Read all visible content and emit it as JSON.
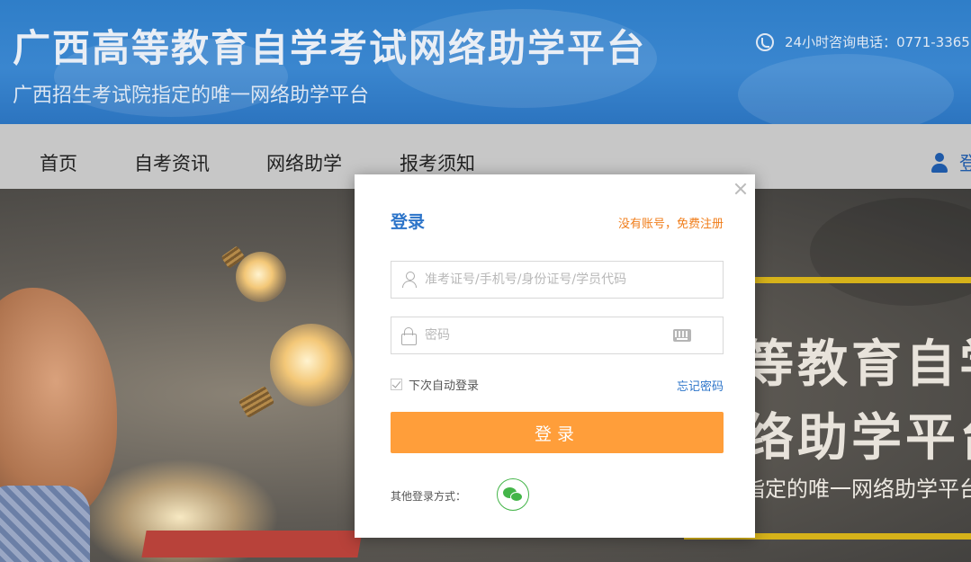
{
  "header": {
    "title": "广西高等教育自学考试网络助学平台",
    "subtitle": "广西招生考试院指定的唯一网络助学平台",
    "hotline_label": "24小时咨询电话：0771-3365",
    "hotline_icon": "phone-icon"
  },
  "nav": {
    "items": [
      {
        "label": "首页"
      },
      {
        "label": "自考资讯"
      },
      {
        "label": "网络助学"
      },
      {
        "label": "报考须知"
      }
    ],
    "login_label": "登",
    "login_icon": "user-icon"
  },
  "banner": {
    "title_line1": "等教育自学",
    "title_line2": "络助学平台",
    "subtitle": "指定的唯一网络助学平台"
  },
  "login_modal": {
    "title": "登录",
    "register_link": "没有账号，免费注册",
    "username_placeholder": "准考证号/手机号/身份证号/学员代码",
    "password_placeholder": "密码",
    "remember_label": "下次自动登录",
    "remember_checked": true,
    "forgot_link": "忘记密码",
    "submit_label": "登录",
    "other_login_label": "其他登录方式：",
    "other_login_methods": [
      "wechat-icon"
    ]
  },
  "colors": {
    "header_blue": "#2f7ec8",
    "link_blue": "#2c74c9",
    "accent_orange": "#ff9e3a",
    "register_orange": "#f07d1a",
    "wechat_green": "#44b549",
    "banner_frame_yellow": "#d6b21a"
  }
}
